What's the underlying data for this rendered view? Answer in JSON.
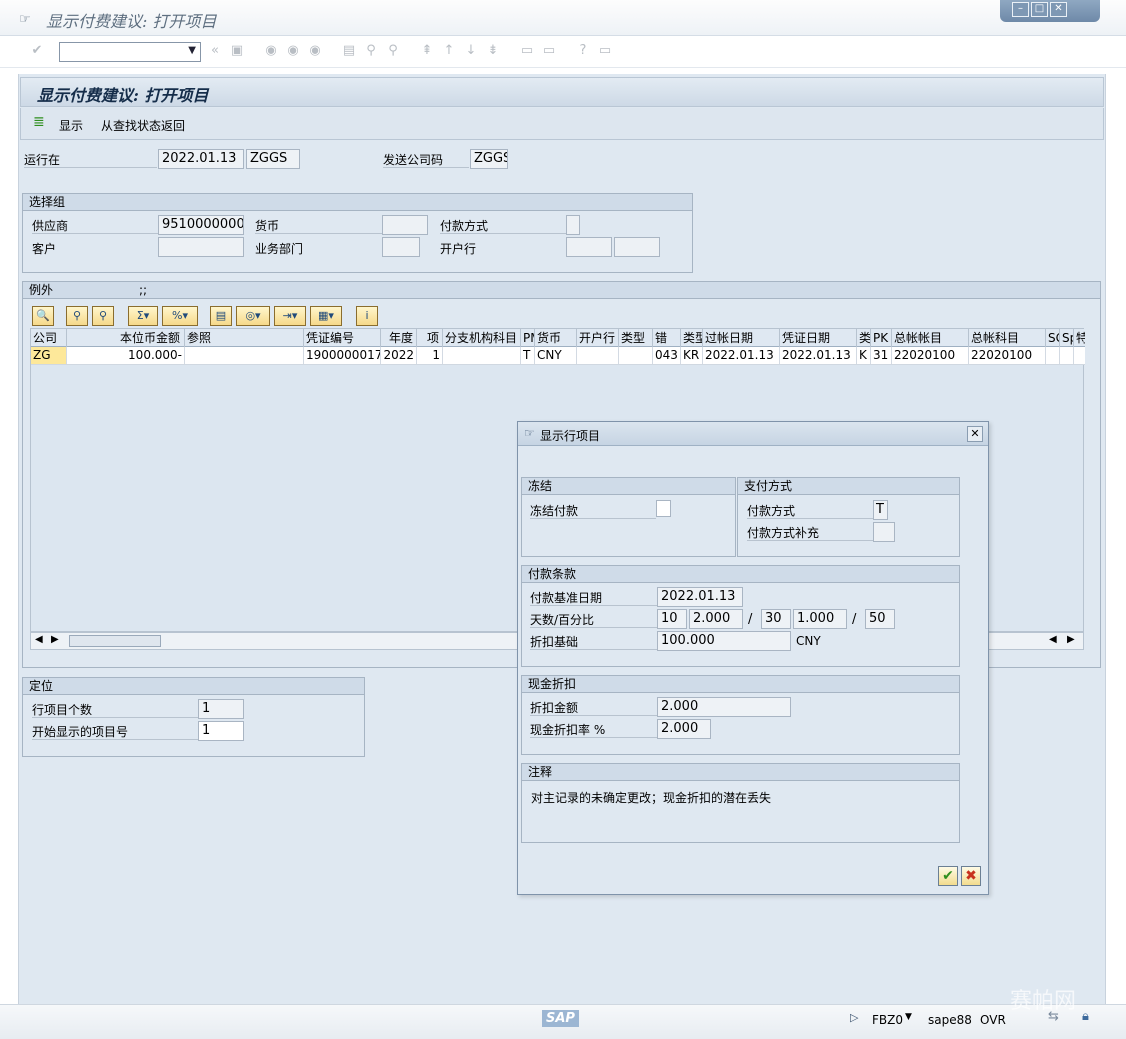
{
  "window": {
    "title": "显示付费建议: 打开项目",
    "controls": [
      "minimize",
      "maximize",
      "close"
    ]
  },
  "app": {
    "title": "显示付费建议: 打开项目",
    "toolbar": {
      "display_label": "显示",
      "return_label": "从查找状态返回"
    }
  },
  "header": {
    "run_on_label": "运行在",
    "run_date": "2022.01.13",
    "run_id": "ZGGS",
    "paying_cc_label": "发送公司码",
    "paying_cc": "ZGGS"
  },
  "selection_group": {
    "title": "选择组",
    "vendor_label": "供应商",
    "vendor": "9510000000",
    "currency_label": "货币",
    "currency": "",
    "payment_method_label": "付款方式",
    "payment_method": "",
    "customer_label": "客户",
    "customer": "",
    "business_area_label": "业务部门",
    "business_area": "",
    "house_bank_label": "开户行",
    "house_bank": ""
  },
  "exceptions": {
    "title": "例外",
    "count_text": ";;",
    "columns": [
      "公司",
      "本位币金额",
      "参照",
      "凭证编号",
      "年度",
      "项",
      "分支机构科目",
      "PM",
      "货币",
      "开户行",
      "类型",
      "错",
      "类型",
      "过帐日期",
      "凭证日期",
      "类",
      "PK",
      "总帐帐目",
      "总帐科目",
      "SG",
      "Sp",
      "特"
    ],
    "rows": [
      [
        "ZG",
        "100.000-",
        "",
        "1900000017",
        "2022",
        "1",
        "",
        "T",
        "CNY",
        "",
        "",
        "043",
        "KR",
        "2022.01.13",
        "2022.01.13",
        "K",
        "31",
        "22020100",
        "22020100",
        "",
        "",
        ""
      ]
    ]
  },
  "positioning": {
    "title": "定位",
    "item_count_label": "行项目个数",
    "item_count": "1",
    "first_item_label": "开始显示的项目号",
    "first_item": "1"
  },
  "dialog": {
    "title": "显示行项目",
    "block": {
      "title": "冻结",
      "payment_block_label": "冻结付款",
      "payment_block": ""
    },
    "payment_method_box": {
      "title": "支付方式",
      "method_label": "付款方式",
      "method": "T",
      "supplement_label": "付款方式补充",
      "supplement": ""
    },
    "terms": {
      "title": "付款条款",
      "baseline_label": "付款基准日期",
      "baseline": "2022.01.13",
      "days_pct_label": "天数/百分比",
      "days1": "10",
      "pct1": "2.000",
      "days2": "30",
      "pct2": "1.000",
      "days3": "50",
      "slash": "/",
      "discount_base_label": "折扣基础",
      "discount_base": "100.000",
      "discount_base_currency": "CNY"
    },
    "cash_discount": {
      "title": "现金折扣",
      "amount_label": "折扣金额",
      "amount": "2.000",
      "rate_label": "现金折扣率 %",
      "rate": "2.000"
    },
    "note": {
      "title": "注释",
      "text": "对主记录的未确定更改；现金折扣的潜在丢失"
    }
  },
  "status": {
    "sap_logo": "SAP",
    "transaction": "FBZ0",
    "server": "sape88",
    "mode": "OVR",
    "watermark": "赛帕网"
  },
  "colors": {
    "accent": "#152d4a",
    "background": "#dfe8f1",
    "ok_green": "#2f8f1f",
    "cancel_red": "#c8321e"
  }
}
